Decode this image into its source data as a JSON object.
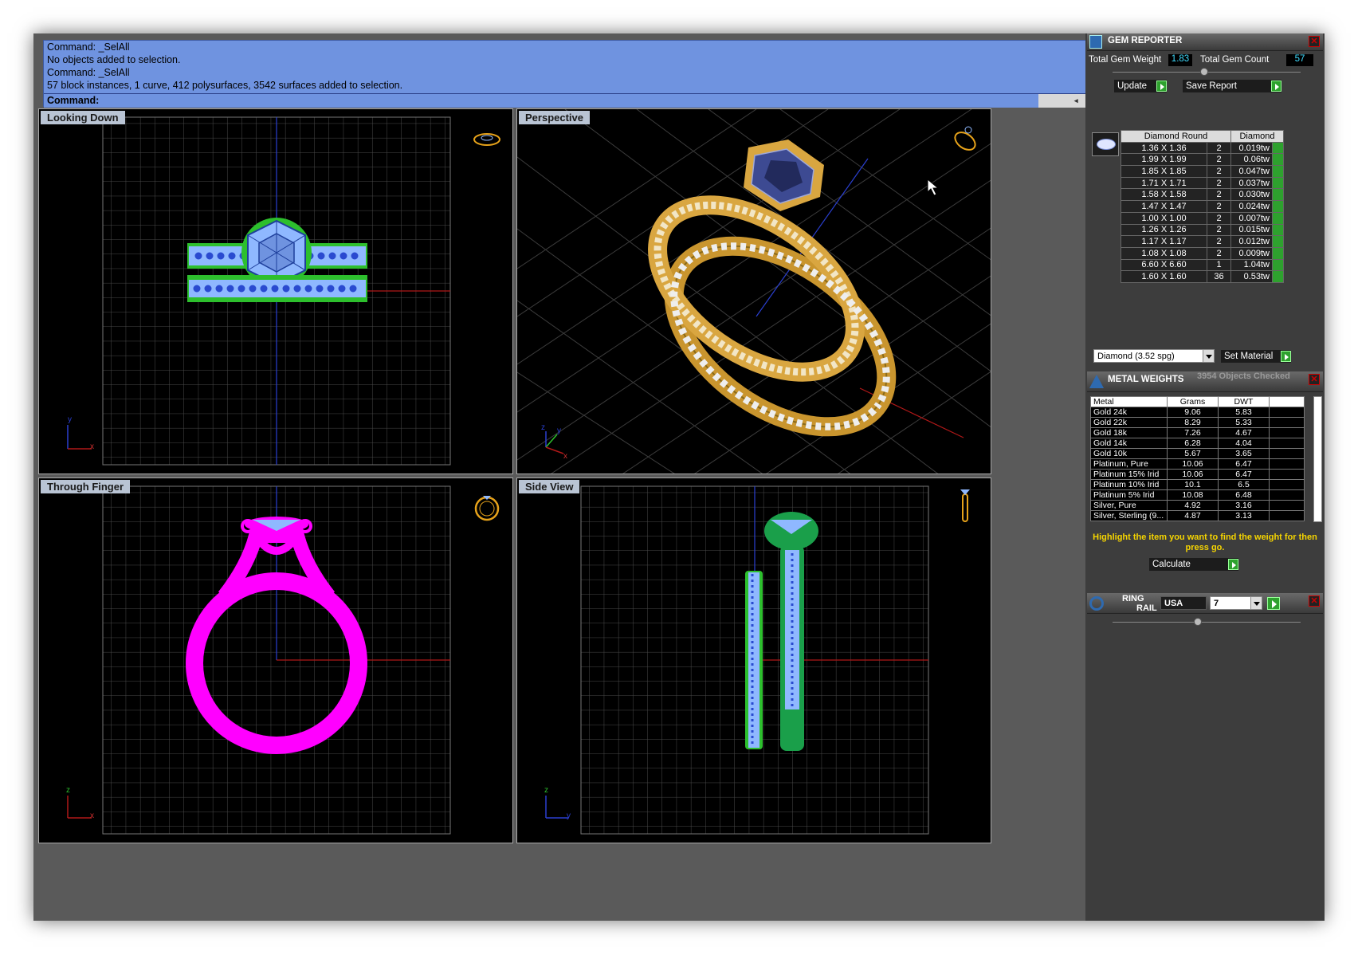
{
  "command": {
    "history": [
      "Command: _SelAll",
      "No objects added to selection.",
      "Command: _SelAll",
      "57 block instances, 1 curve, 412 polysurfaces, 3542 surfaces added to selection."
    ],
    "prompt": "Command:"
  },
  "viewports": {
    "top_left": {
      "title": "Looking Down",
      "axis_a": "y",
      "axis_b": "x"
    },
    "top_right": {
      "title": "Perspective",
      "axis_a": "z",
      "axis_b": "y",
      "axis_c": "x"
    },
    "bottom_left": {
      "title": "Through Finger",
      "axis_a": "z",
      "axis_b": "x"
    },
    "bottom_right": {
      "title": "Side View",
      "axis_a": "z",
      "axis_b": "y"
    }
  },
  "gem_reporter": {
    "title": "GEM REPORTER",
    "total_weight_label": "Total Gem Weight",
    "total_weight": "1.83",
    "total_count_label": "Total Gem Count",
    "total_count": "57",
    "update_label": "Update",
    "save_label": "Save Report",
    "col_shape": "Diamond Round",
    "col_material": "Diamond",
    "rows": [
      {
        "size": "1.36 X 1.36",
        "qty": "2",
        "wt": "0.019tw"
      },
      {
        "size": "1.99 X 1.99",
        "qty": "2",
        "wt": "0.06tw"
      },
      {
        "size": "1.85 X 1.85",
        "qty": "2",
        "wt": "0.047tw"
      },
      {
        "size": "1.71 X 1.71",
        "qty": "2",
        "wt": "0.037tw"
      },
      {
        "size": "1.58 X 1.58",
        "qty": "2",
        "wt": "0.030tw"
      },
      {
        "size": "1.47 X 1.47",
        "qty": "2",
        "wt": "0.024tw"
      },
      {
        "size": "1.00 X 1.00",
        "qty": "2",
        "wt": "0.007tw"
      },
      {
        "size": "1.26 X 1.26",
        "qty": "2",
        "wt": "0.015tw"
      },
      {
        "size": "1.17 X 1.17",
        "qty": "2",
        "wt": "0.012tw"
      },
      {
        "size": "1.08 X 1.08",
        "qty": "2",
        "wt": "0.009tw"
      },
      {
        "size": "6.60 X 6.60",
        "qty": "1",
        "wt": "1.04tw"
      },
      {
        "size": "1.60 X 1.60",
        "qty": "36",
        "wt": "0.53tw"
      }
    ],
    "material_select": "Diamond    (3.52 spg)",
    "set_material_label": "Set Material"
  },
  "metal_weights": {
    "title": "METAL WEIGHTS",
    "objects_checked": "3954 Objects Checked",
    "col_metal": "Metal",
    "col_grams": "Grams",
    "col_dwt": "DWT",
    "rows": [
      {
        "metal": "Gold 24k",
        "grams": "9.06",
        "dwt": "5.83"
      },
      {
        "metal": "Gold 22k",
        "grams": "8.29",
        "dwt": "5.33"
      },
      {
        "metal": "Gold 18k",
        "grams": "7.26",
        "dwt": "4.67"
      },
      {
        "metal": "Gold 14k",
        "grams": "6.28",
        "dwt": "4.04"
      },
      {
        "metal": "Gold 10k",
        "grams": "5.67",
        "dwt": "3.65"
      },
      {
        "metal": "Platinum, Pure",
        "grams": "10.06",
        "dwt": "6.47"
      },
      {
        "metal": "Platinum 15% Irid",
        "grams": "10.06",
        "dwt": "6.47"
      },
      {
        "metal": "Platinum 10% Irid",
        "grams": "10.1",
        "dwt": "6.5"
      },
      {
        "metal": "Platinum 5% Irid",
        "grams": "10.08",
        "dwt": "6.48"
      },
      {
        "metal": "Silver, Pure",
        "grams": "4.92",
        "dwt": "3.16"
      },
      {
        "metal": "Silver, Sterling (9...",
        "grams": "4.87",
        "dwt": "3.13"
      }
    ],
    "hint": "Highlight the item you want to find the weight for then press go.",
    "calculate_label": "Calculate"
  },
  "ring_rail": {
    "title_line1": "RING",
    "title_line2": "RAIL",
    "standard": "USA",
    "size": "7"
  },
  "colors": {
    "command_bg": "#6f93e0",
    "hint_text": "#f5d400",
    "value_text": "#3fdcff",
    "go_button": "#2ea12e",
    "magenta_wire": "#ff00ff",
    "green_wire": "#2dbf2d",
    "blue_wire": "#8fb8ff",
    "gold": "#c9952e"
  }
}
